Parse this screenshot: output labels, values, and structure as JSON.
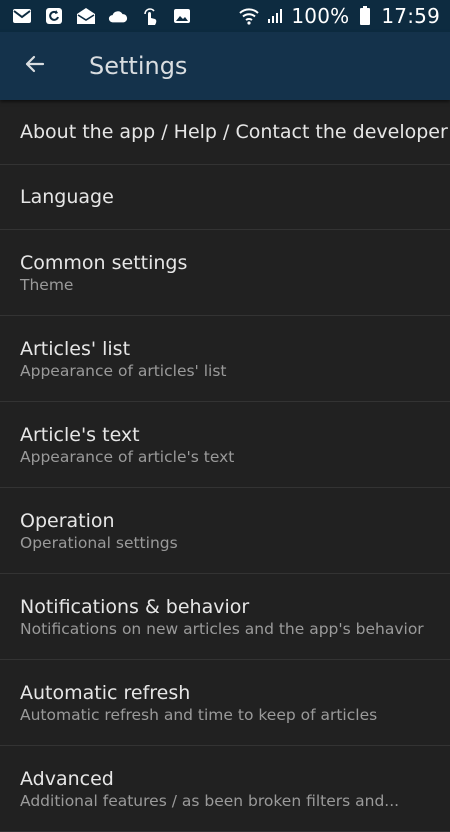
{
  "status_bar": {
    "battery": "100%",
    "time": "17:59",
    "icons": [
      "email-icon",
      "sync-icon",
      "mail-open-icon",
      "cloud-icon",
      "touch-icon",
      "image-icon",
      "wifi-icon",
      "signal-icon",
      "battery-icon"
    ]
  },
  "toolbar": {
    "back_icon": "arrow-back-icon",
    "title": "Settings",
    "color": "#14324b"
  },
  "settings": {
    "items": [
      {
        "title": "About the app / Help / Contact the developer",
        "subtitle": ""
      },
      {
        "title": "Language",
        "subtitle": ""
      },
      {
        "title": "Common settings",
        "subtitle": "Theme"
      },
      {
        "title": "Articles' list",
        "subtitle": "Appearance of articles' list"
      },
      {
        "title": "Article's text",
        "subtitle": "Appearance of article's text"
      },
      {
        "title": "Operation",
        "subtitle": "Operational settings"
      },
      {
        "title": "Notifications & behavior",
        "subtitle": "Notifications on new articles and the app's behavior"
      },
      {
        "title": "Automatic refresh",
        "subtitle": "Automatic refresh and time to keep of articles"
      },
      {
        "title": "Advanced",
        "subtitle": "Additional features / as been broken filters and..."
      }
    ]
  }
}
